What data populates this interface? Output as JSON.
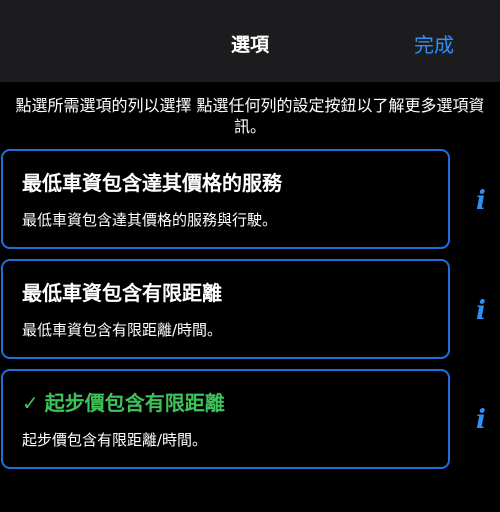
{
  "nav": {
    "title": "選項",
    "done_label": "完成"
  },
  "instructions": "點選所需選項的列以選擇 點選任何列的設定按鈕以了解更多選項資訊。",
  "options": [
    {
      "title": "最低車資包含達其價格的服務",
      "description": "最低車資包含達其價格的服務與行駛。",
      "selected": false,
      "info_icon": "i"
    },
    {
      "title": "最低車資包含有限距離",
      "description": "最低車資包含有限距離/時間。",
      "selected": false,
      "info_icon": "i"
    },
    {
      "title": "起步價包含有限距離",
      "description": "起步價包含有限距離/時間。",
      "selected": true,
      "check_icon": "✓",
      "info_icon": "i"
    }
  ],
  "colors": {
    "accent": "#2f8ef8",
    "selected": "#3ec35a",
    "card_border": "#1e6fd9",
    "nav_background": "#1c1c1e"
  }
}
